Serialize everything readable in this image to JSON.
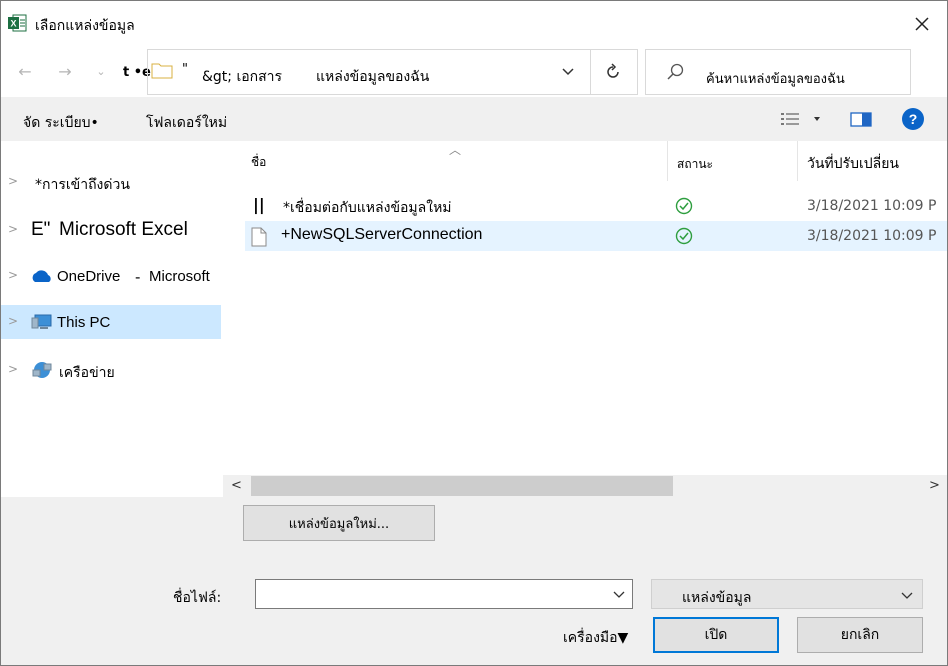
{
  "window": {
    "title": "เลือกแหล่งข้อมูล"
  },
  "address": {
    "segments": [
      "t •e",
      "\"",
      "&gt; เอกสาร",
      "แหล่งข้อมูลของฉัน"
    ],
    "search_placeholder": "ค้นหาแหล่งข้อมูลของฉัน"
  },
  "toolbar": {
    "organize": "จัด ระเบียบ•",
    "new_folder": "โฟลเดอร์ใหม่"
  },
  "nav": {
    "items": [
      {
        "label": "*การเข้าถึงด่วน"
      },
      {
        "label": "Microsoft Excel",
        "icon_text": "E\""
      },
      {
        "label": "OneDrive",
        "sep": "-",
        "suffix": "Microsoft"
      },
      {
        "label": "This PC"
      },
      {
        "label": "เครือข่าย"
      }
    ]
  },
  "columns": {
    "name": "ชื่อ",
    "status": "สถานะ",
    "date": "วันที่ปรับเปลี่ยน"
  },
  "files": [
    {
      "icon_text": "||",
      "name": "*เชื่อมต่อกับแหล่งข้อมูลใหม่",
      "date": "3/18/2021 10:09 P"
    },
    {
      "name": "+NewSQLServerConnection",
      "date": "3/18/2021 10:09 P"
    }
  ],
  "buttons": {
    "new_source": "แหล่งข้อมูลใหม่...",
    "open": "เปิด",
    "cancel": "ยกเลิก",
    "tools": "เครื่องมือ▼"
  },
  "filename": {
    "label": "ชื่อไฟล์:",
    "value": ""
  },
  "filetype": {
    "selected": "แหล่งข้อมูล"
  },
  "colors": {
    "excel_green": "#1d6f42",
    "selected_nav": "#cce8ff",
    "selected_row": "#e5f3ff",
    "status_green": "#2e9e3f",
    "help_blue": "#0a64c8"
  }
}
